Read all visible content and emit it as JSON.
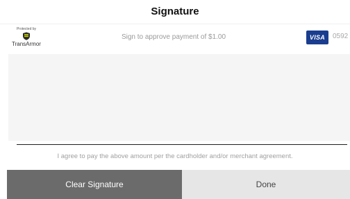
{
  "header": {
    "title": "Signature"
  },
  "security_logo": {
    "protected_by": "Protected by",
    "brand": "TransArmor"
  },
  "payment": {
    "approve_text": "Sign to approve payment of  $1.00",
    "card_brand": "VISA",
    "card_last_digits": "0592"
  },
  "agreement_text": "I agree to pay the above amount per the cardholder and/or merchant agreement.",
  "buttons": {
    "clear_label": "Clear Signature",
    "done_label": "Done"
  },
  "colors": {
    "visa_badge": "#1a3d8f",
    "clear_button": "#6b6b6b",
    "done_button": "#e6e6e6",
    "signature_pad": "#f5f5f5"
  }
}
